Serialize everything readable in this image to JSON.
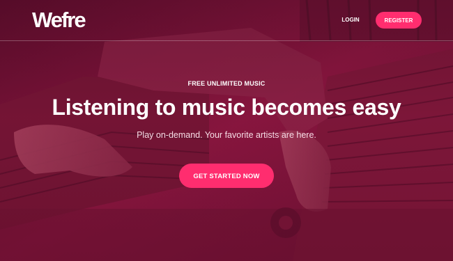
{
  "brand": {
    "logo_text": "Wefre",
    "accent_color": "#ff2d6f",
    "overlay_color": "#7a1236"
  },
  "nav": {
    "login_label": "LOGIN",
    "register_label": "REGISTER"
  },
  "hero": {
    "eyebrow": "FREE UNLIMITED MUSIC",
    "headline": "Listening to music becomes easy",
    "subtitle": "Play on-demand. Your favorite artists are here.",
    "cta_label": "GET STARTED NOW"
  }
}
